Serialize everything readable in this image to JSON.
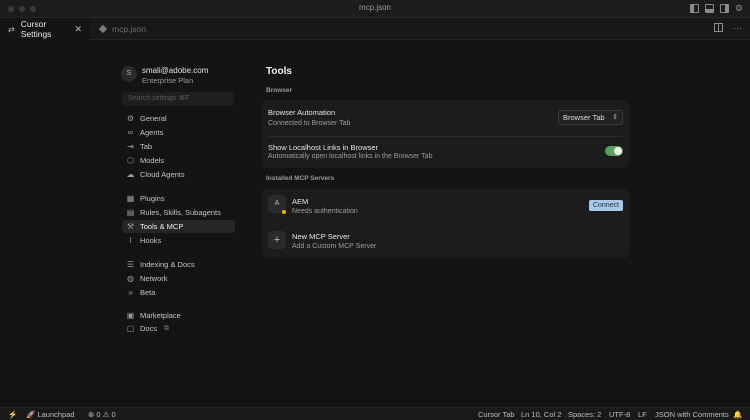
{
  "window": {
    "title": "mcp.json"
  },
  "tabs": [
    {
      "label": "Cursor Settings",
      "active": true
    },
    {
      "label": "mcp.json",
      "active": false
    }
  ],
  "user": {
    "avatar": "S",
    "email": "smali@adobe.com",
    "plan": "Enterprise Plan"
  },
  "search": {
    "placeholder": "Search settings ⌘F"
  },
  "nav": {
    "general": "General",
    "agents": "Agents",
    "tab": "Tab",
    "models": "Models",
    "cloud_agents": "Cloud Agents",
    "plugins": "Plugins",
    "rules": "Rules, Skills, Subagents",
    "tools": "Tools & MCP",
    "hooks": "Hooks",
    "indexing": "Indexing & Docs",
    "network": "Network",
    "beta": "Beta",
    "marketplace": "Marketplace",
    "docs": "Docs"
  },
  "main": {
    "title": "Tools",
    "browser_section": "Browser",
    "browser_automation": {
      "title": "Browser Automation",
      "subtitle": "Connected to Browser Tab",
      "select_value": "Browser Tab"
    },
    "localhost_links": {
      "title": "Show Localhost Links in Browser",
      "subtitle": "Automatically open localhost links in the Browser Tab",
      "enabled": true
    },
    "mcp_section": "Installed MCP Servers",
    "aem": {
      "icon": "A",
      "name": "AEM",
      "status": "Needs authentication",
      "action": "Connect"
    },
    "new_server": {
      "title": "New MCP Server",
      "subtitle": "Add a Custom MCP Server"
    }
  },
  "statusbar": {
    "launchpad": "Launchpad",
    "errors": "0",
    "warnings": "0",
    "indent": "Cursor Tab",
    "position": "Ln 10, Col 2",
    "spaces": "Spaces: 2",
    "encoding": "UTF-8",
    "eol": "LF",
    "language": "JSON with Comments"
  },
  "colors": {
    "accent_toggle": "#5aa05a",
    "connect_button": "#a8c8e8",
    "status_warning": "#e6b400"
  }
}
